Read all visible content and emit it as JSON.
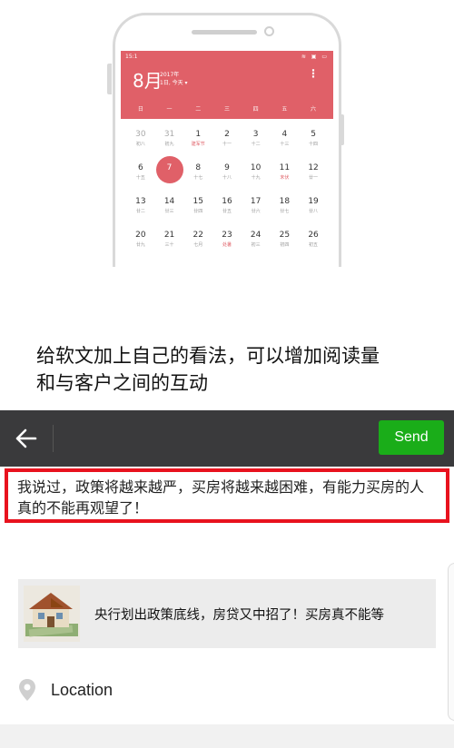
{
  "calendar": {
    "status_left": "15:1",
    "status_icons": "≋ ▣ ▭",
    "month": "8月",
    "year": "2017年",
    "sub": "1日, 今天 ▾",
    "menu": "⋮",
    "weekdays": [
      "日",
      "一",
      "二",
      "三",
      "四",
      "五",
      "六"
    ],
    "rows": [
      [
        {
          "num": "30",
          "lunar": "初八",
          "grey": true
        },
        {
          "num": "31",
          "lunar": "初九",
          "grey": true
        },
        {
          "num": "1",
          "lunar": "建军节",
          "red": true
        },
        {
          "num": "2",
          "lunar": "十一"
        },
        {
          "num": "3",
          "lunar": "十二"
        },
        {
          "num": "4",
          "lunar": "十三"
        },
        {
          "num": "5",
          "lunar": "十四"
        }
      ],
      [
        {
          "num": "6",
          "lunar": "十五"
        },
        {
          "num": "7",
          "lunar": "",
          "selected": true
        },
        {
          "num": "8",
          "lunar": "十七"
        },
        {
          "num": "9",
          "lunar": "十八"
        },
        {
          "num": "10",
          "lunar": "十九"
        },
        {
          "num": "11",
          "lunar": "末伏",
          "red": true
        },
        {
          "num": "12",
          "lunar": "廿一"
        }
      ],
      [
        {
          "num": "13",
          "lunar": "廿二"
        },
        {
          "num": "14",
          "lunar": "廿三"
        },
        {
          "num": "15",
          "lunar": "廿四"
        },
        {
          "num": "16",
          "lunar": "廿五"
        },
        {
          "num": "17",
          "lunar": "廿六"
        },
        {
          "num": "18",
          "lunar": "廿七"
        },
        {
          "num": "19",
          "lunar": "廿八"
        }
      ],
      [
        {
          "num": "20",
          "lunar": "廿九"
        },
        {
          "num": "21",
          "lunar": "三十"
        },
        {
          "num": "22",
          "lunar": "七月"
        },
        {
          "num": "23",
          "lunar": "处暑",
          "red": true
        },
        {
          "num": "24",
          "lunar": "初三"
        },
        {
          "num": "25",
          "lunar": "初四"
        },
        {
          "num": "26",
          "lunar": "初五"
        }
      ]
    ]
  },
  "caption": {
    "line1": "给软文加上自己的看法，可以增加阅读量",
    "line2": "和与客户之间的互动"
  },
  "share": {
    "back_icon": "arrow-left-icon",
    "send_label": "Send",
    "message": "我说过，政策将越来越严，买房将越来越困难，有能力买房的人真的不能再观望了！",
    "article_title": "央行划出政策底线，房贷又中招了！买房真不能等",
    "location_label": "Location",
    "colors": {
      "topbar": "#3a3a3c",
      "send_button": "#1aad19",
      "highlight_border": "#e8121e",
      "calendar_accent": "#e06068"
    }
  }
}
